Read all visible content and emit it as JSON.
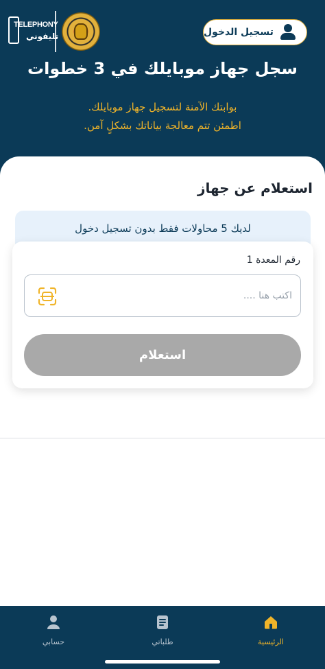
{
  "header": {
    "logo_text_en": "TELEPHONY",
    "logo_text_ar": "تليفوني",
    "login_label": "تسجيل الدخول",
    "headline": "سجل جهاز موبايلك في 3 خطوات",
    "subtitle_line1": "بوابتك الآمنة لتسجيل جهاز موبايلك.",
    "subtitle_line2": "اطمئن تتم معالجة بياناتك بشكلٍ آمن."
  },
  "main": {
    "section_title": "استعلام عن جهاز",
    "attempts_notice": "لديك 5 محاولات فقط بدون تسجيل دخول",
    "field_label": "رقم المعدة 1",
    "field_placeholder": "اكتب هنا ....",
    "field_value": "",
    "submit_label": "استعلام"
  },
  "bottom_nav": {
    "items": [
      {
        "label": "الرئيسية",
        "icon": "home-icon",
        "active": true
      },
      {
        "label": "طلباتي",
        "icon": "document-icon",
        "active": false
      },
      {
        "label": "حسابي",
        "icon": "user-icon",
        "active": false
      }
    ]
  },
  "colors": {
    "primary": "#0b3a57",
    "accent": "#f0b429",
    "disabled_button": "#a9a9a9",
    "notice_bg": "#e7f1fb"
  }
}
